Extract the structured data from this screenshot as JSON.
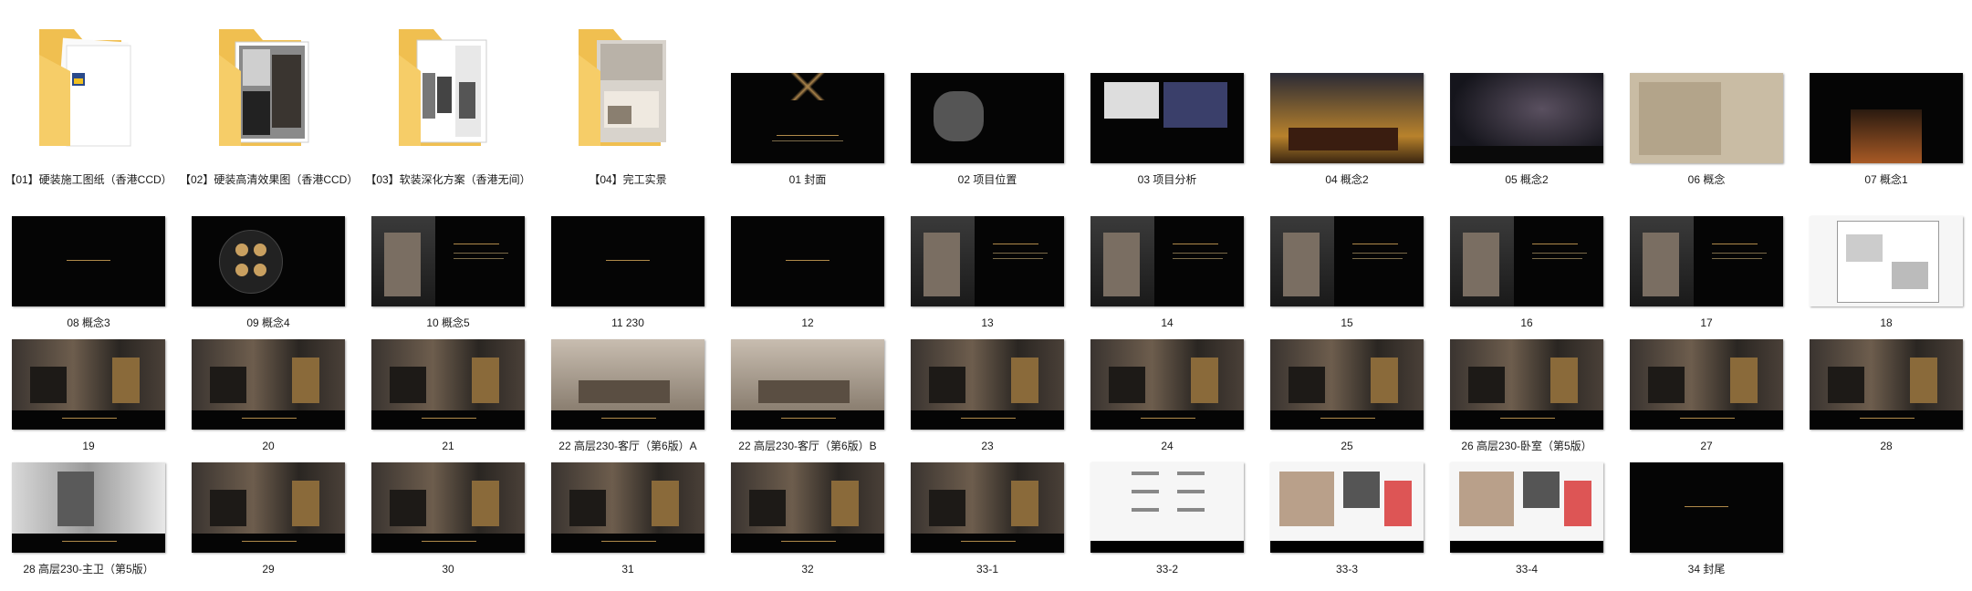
{
  "folders": [
    {
      "name": "【01】硬装施工图纸（香港CCD）"
    },
    {
      "name": "【02】硬装高清效果图（香港CCD）"
    },
    {
      "name": "【03】软装深化方案（香港无间）"
    },
    {
      "name": "【04】完工实景"
    }
  ],
  "slides": [
    "01 封面",
    "02 项目位置",
    "03 项目分析",
    "04 概念2",
    "05 概念2",
    "06 概念",
    "07 概念1",
    "08 概念3",
    "09 概念4",
    "10 概念5",
    "11 230",
    "12",
    "13",
    "14",
    "15",
    "16",
    "17",
    "18",
    "19",
    "20",
    "21",
    "22 高层230-客厅（第6版）A",
    "22 高层230-客厅（第6版）B",
    "23",
    "24",
    "25",
    "26 高层230-卧室（第5版）",
    "27",
    "28",
    "28 高层230-主卫（第5版）",
    "29",
    "30",
    "31",
    "32",
    "33-1",
    "33-2",
    "33-3",
    "33-4",
    "34 封尾"
  ],
  "colors": {
    "folder": "#f3c65a",
    "folder_dark": "#e8b445",
    "slide_bg": "#050505",
    "accent": "#b08a4a"
  }
}
